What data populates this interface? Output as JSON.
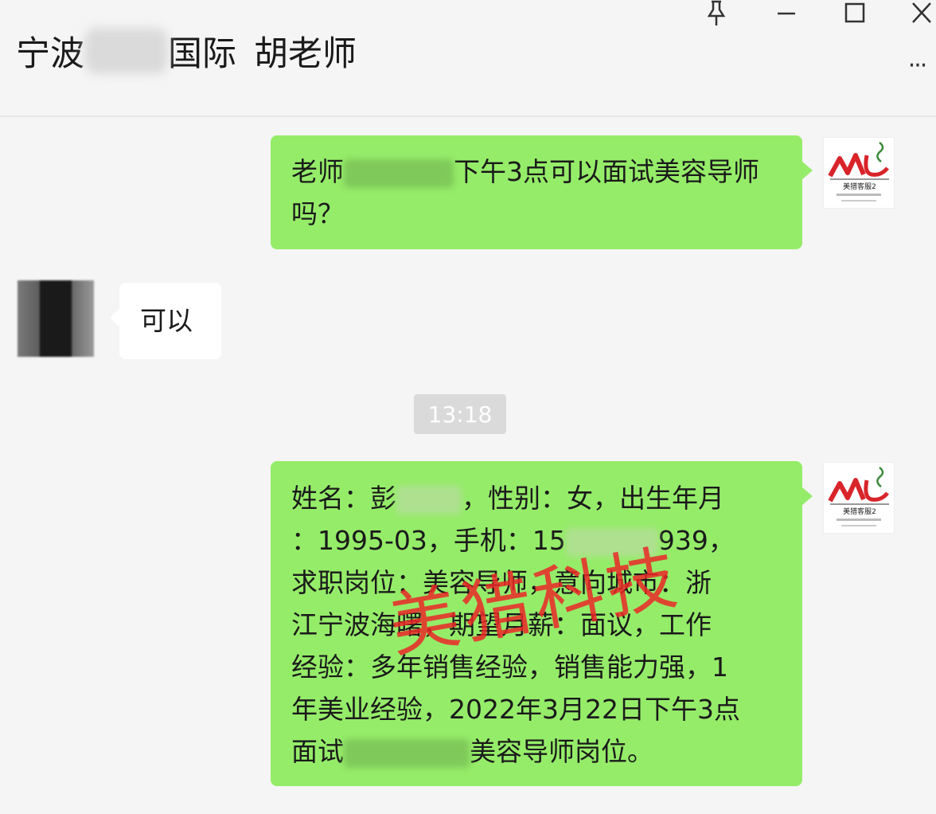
{
  "chat": {
    "title_part1": "宁波",
    "title_part2": "国际",
    "title_contact": "胡老师",
    "more_label": "···"
  },
  "messages": {
    "m1": {
      "line1_start": "老师",
      "line1_end": "下午3点可以面试美容导师",
      "line2": "吗？"
    },
    "m2": {
      "text": "可以"
    },
    "timestamp": "13:18",
    "m3": {
      "l1_a": "姓名：彭",
      "l1_b": "，性别：女，出生年月",
      "l2_a": "：1995-03，手机：15",
      "l2_b": "939，",
      "l3": "求职岗位：美容导师，意向城市：浙",
      "l4": "江宁波海曙，期望月薪：面议，工作",
      "l5": "经验：多年销售经验，销售能力强，1",
      "l6": "年美业经验，2022年3月22日下午3点",
      "l7_a": "面试",
      "l7_b": "美容导师岗位。"
    }
  },
  "avatar_me": {
    "logo_text": "美猎客服2"
  },
  "watermark": "美猎科技"
}
